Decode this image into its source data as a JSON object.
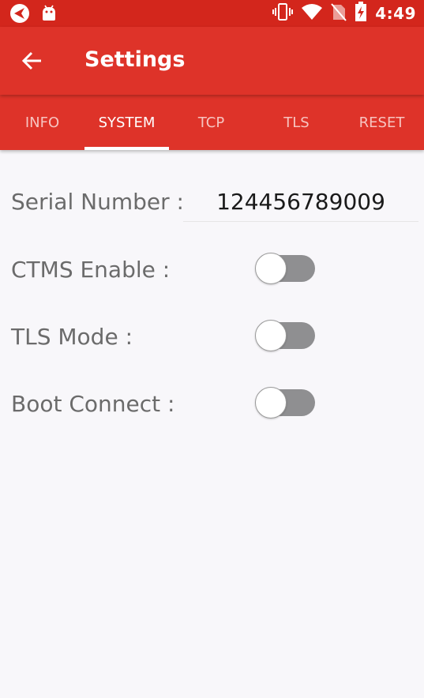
{
  "status_bar": {
    "time": "4:49",
    "icons": [
      "app-notification-icon",
      "android-icon",
      "vibrate-icon",
      "wifi-icon",
      "no-sim-icon",
      "battery-charging-icon"
    ]
  },
  "app_bar": {
    "title": "Settings",
    "back_icon": "arrow-left-icon"
  },
  "tabs": [
    {
      "label": "INFO",
      "active": false
    },
    {
      "label": "SYSTEM",
      "active": true
    },
    {
      "label": "TCP",
      "active": false
    },
    {
      "label": "TLS",
      "active": false
    },
    {
      "label": "RESET",
      "active": false
    }
  ],
  "settings": {
    "serial_number": {
      "label": "Serial Number :",
      "value": "124456789009"
    },
    "ctms_enable": {
      "label": "CTMS Enable :",
      "on": false
    },
    "tls_mode": {
      "label": "TLS Mode :",
      "on": false
    },
    "boot_connect": {
      "label": "Boot Connect :",
      "on": false
    }
  },
  "colors": {
    "status_bar": "#d3261c",
    "app_bar": "#de3329",
    "background": "#f8f7fa",
    "switch_track_off": "#8f8f91"
  }
}
